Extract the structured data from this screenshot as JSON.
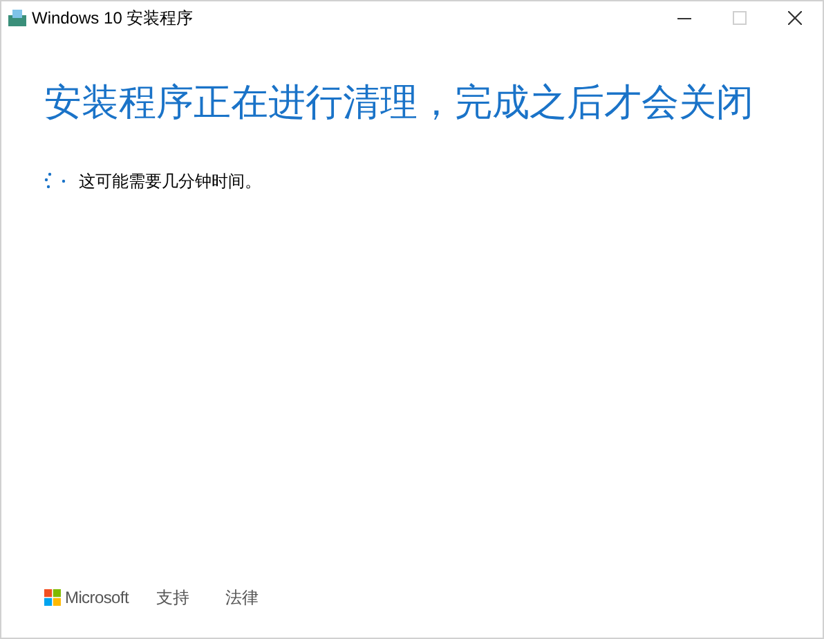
{
  "window": {
    "title": "Windows 10 安装程序",
    "maximize": {
      "disabled": true
    }
  },
  "heading": "安装程序正在进行清理，完成之后才会关闭",
  "status": "这可能需要几分钟时间。",
  "footer": {
    "brand": "Microsoft",
    "links": [
      "支持",
      "法律"
    ]
  }
}
